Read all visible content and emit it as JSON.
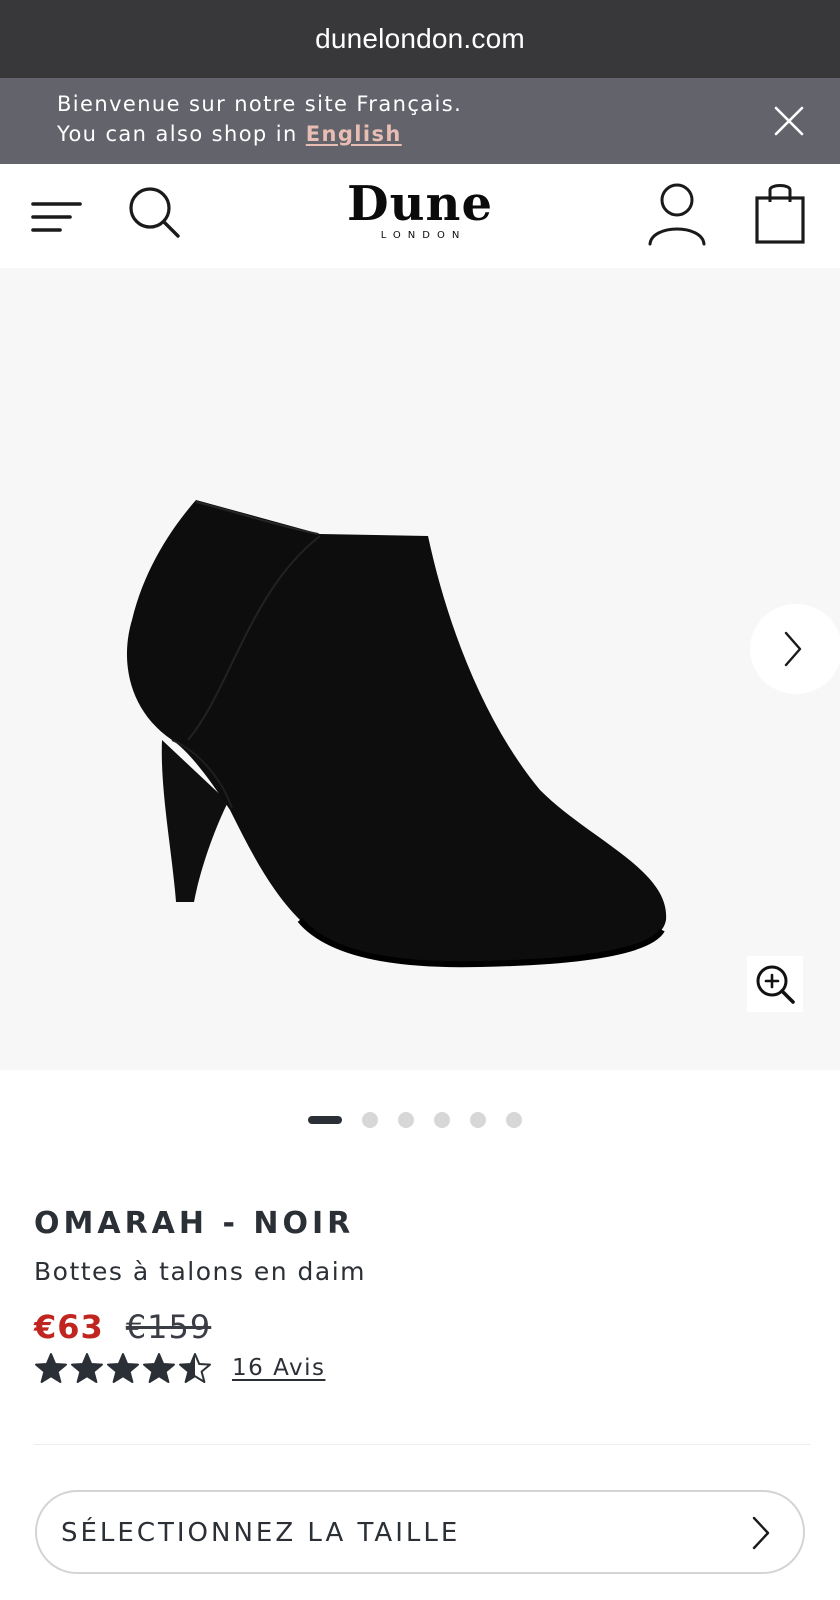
{
  "browser": {
    "url": "dunelondon.com"
  },
  "banner": {
    "line1": "Bienvenue sur notre site Français.",
    "line2_prefix": "You can also shop in ",
    "line2_link": "English",
    "link_color": "#e8bdb4"
  },
  "header": {
    "logo": {
      "brand": "Dune",
      "sub": "LONDON"
    },
    "icons": [
      "menu-icon",
      "search-icon",
      "account-icon",
      "shopping-bag-icon"
    ]
  },
  "gallery": {
    "image": "black suede heeled ankle boot",
    "slide_count": 6,
    "active_slide": 1,
    "icons": [
      "chevron-right-icon",
      "zoom-in-icon"
    ]
  },
  "product": {
    "name": "OMARAH - NOIR",
    "description": "Bottes à talons en daim",
    "price_current": "€63",
    "price_original": "€159",
    "price_color": "#c0261f",
    "rating": 4.5,
    "rating_max": 5,
    "reviews_label": "16 Avis"
  },
  "size_selector": {
    "label": "SÉLECTIONNEZ LA TAILLE"
  }
}
